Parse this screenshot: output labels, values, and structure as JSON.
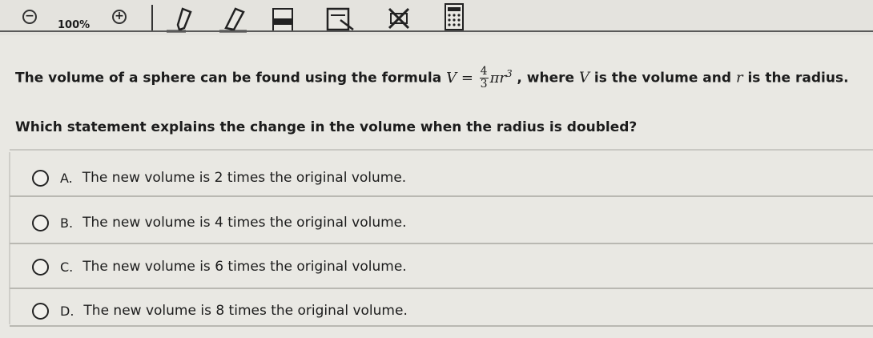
{
  "toolbar": {
    "zoom_out_icon": "zoom-out-icon",
    "zoom_level": "100%",
    "zoom_in_icon": "zoom-in-icon",
    "tools": [
      "pencil-icon",
      "eraser-icon",
      "highlighter-icon",
      "notepad-icon",
      "eliminate-icon",
      "calculator-icon"
    ]
  },
  "prompt": {
    "before": "The volume of a sphere can be found using the formula",
    "formula_lhs": "V =",
    "frac_num": "4",
    "frac_den": "3",
    "formula_rhs": "πr",
    "exponent": "3",
    "after_1": ", where",
    "var_v": "V",
    "after_2": "is the volume and",
    "var_r": "r",
    "after_3": "is the radius."
  },
  "question": "Which statement explains the change in the volume when the radius is doubled?",
  "answers": [
    {
      "letter": "A.",
      "text": "The new volume is 2 times the original volume."
    },
    {
      "letter": "B.",
      "text": "The new volume is 4 times the original volume."
    },
    {
      "letter": "C.",
      "text": "The new volume is 6 times the original volume."
    },
    {
      "letter": "D.",
      "text": "The new volume is 8 times the original volume."
    }
  ]
}
